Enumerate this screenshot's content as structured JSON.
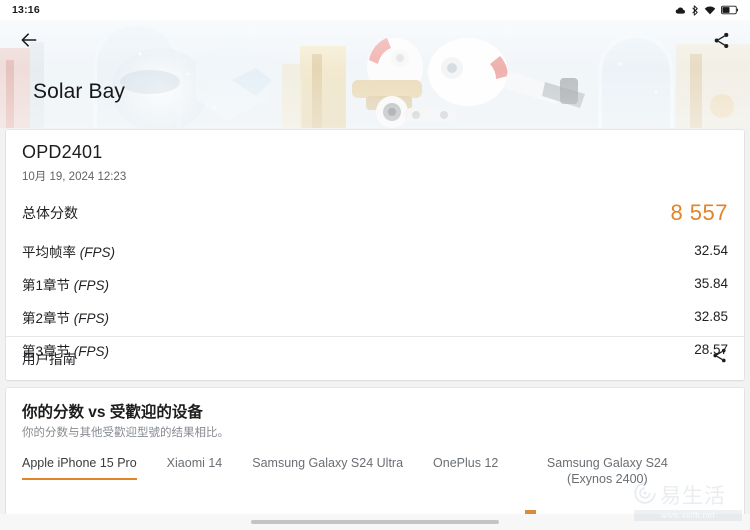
{
  "statusbar": {
    "time": "13:16",
    "icons": [
      "weather-icon",
      "bluetooth-icon",
      "wifi-icon",
      "battery-icon"
    ]
  },
  "hero": {
    "title": "Solar Bay",
    "back_icon": "back-arrow-icon",
    "share_icon": "share-icon"
  },
  "result": {
    "device_name": "OPD2401",
    "date": "10月 19, 2024 12:23",
    "total": {
      "label": "总体分数",
      "value": "8 557"
    },
    "metrics": [
      {
        "label": "平均帧率",
        "unit": "(FPS)",
        "value": "32.54"
      },
      {
        "label": "第1章节",
        "unit": "(FPS)",
        "value": "35.84"
      },
      {
        "label": "第2章节",
        "unit": "(FPS)",
        "value": "32.85"
      },
      {
        "label": "第3章节",
        "unit": "(FPS)",
        "value": "28.57"
      }
    ],
    "guide": {
      "label": "用户指南",
      "share_icon": "share-icon"
    }
  },
  "compare": {
    "title": "你的分数 vs 受歡迎的设备",
    "subtitle": "你的分数与其他受歡迎型號的结果相比。",
    "tabs": [
      {
        "label": "Apple iPhone 15 Pro",
        "active": true
      },
      {
        "label": "Xiaomi 14",
        "active": false
      },
      {
        "label": "Samsung Galaxy S24 Ultra",
        "active": false
      },
      {
        "label": "OnePlus 12",
        "active": false
      },
      {
        "label": "Samsung Galaxy S24 (Exynos 2400)",
        "active": false
      }
    ]
  },
  "watermark": {
    "brand": "易生活",
    "url": "www.xellb.net"
  },
  "colors": {
    "accent": "#e08426",
    "text": "#202124",
    "muted": "#868b90"
  }
}
